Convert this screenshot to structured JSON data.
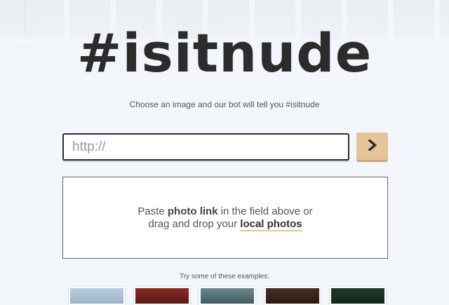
{
  "header": {
    "title": "#isitnude",
    "subtitle": "Choose an image and our bot will tell you #isitnude"
  },
  "search": {
    "placeholder": "http://",
    "go_icon": "chevron-right-icon"
  },
  "drop_zone": {
    "line1_prefix": "Paste ",
    "line1_bold": "photo link",
    "line1_suffix": " in the field above or",
    "line2_prefix": "drag and drop your ",
    "line2_link": "local photos"
  },
  "examples": {
    "label": "Try some of these examples:"
  },
  "colors": {
    "accent": "#e6c49a",
    "title": "#2c2c2c",
    "background": "#f3f6fa"
  }
}
